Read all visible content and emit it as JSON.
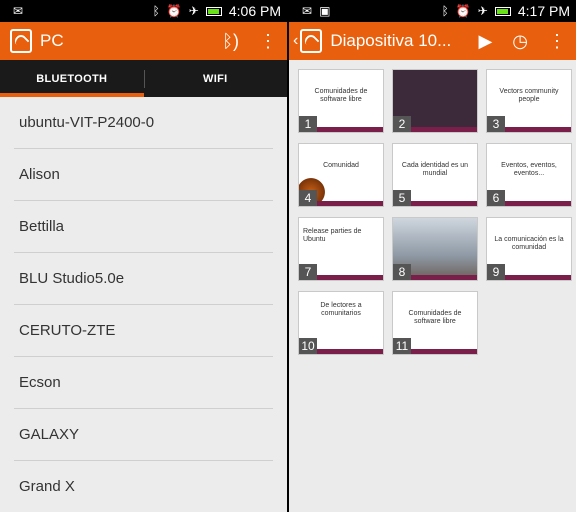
{
  "left": {
    "status": {
      "time": "4:06 PM"
    },
    "appbar": {
      "title": "PC"
    },
    "tabs": [
      {
        "label": "BLUETOOTH"
      },
      {
        "label": "WIFI"
      }
    ],
    "devices": [
      "ubuntu-VIT-P2400-0",
      "Alison",
      "Bettilla",
      "BLU Studio5.0e",
      "CERUTO-ZTE",
      "Ecson",
      "GALAXY",
      "Grand X"
    ]
  },
  "right": {
    "status": {
      "time": "4:17 PM"
    },
    "appbar": {
      "title": "Diapositiva 10..."
    },
    "slides": [
      {
        "num": "1",
        "text": "Comunidades de software libre"
      },
      {
        "num": "2",
        "text": ""
      },
      {
        "num": "3",
        "text": "Vectors community people"
      },
      {
        "num": "4",
        "text": "Comunidad"
      },
      {
        "num": "5",
        "text": "Cada identidad es un mundial"
      },
      {
        "num": "6",
        "text": "Eventos, eventos, eventos..."
      },
      {
        "num": "7",
        "text": "Release parties de Ubuntu"
      },
      {
        "num": "8",
        "text": ""
      },
      {
        "num": "9",
        "text": "La comunicación es la comunidad"
      },
      {
        "num": "10",
        "text": "De lectores a comunitarios"
      },
      {
        "num": "11",
        "text": "Comunidades de software libre"
      }
    ]
  }
}
